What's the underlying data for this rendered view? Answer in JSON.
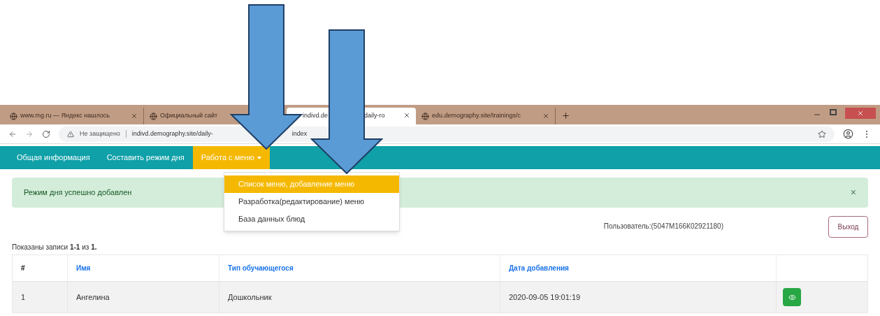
{
  "browser": {
    "tabs": [
      {
        "label": "www.mg.ru — Яндекс нашлось",
        "selected": false
      },
      {
        "label": "Официальный сайт",
        "selected": false
      },
      {
        "label": "indivd.de",
        "label_after": "daily-ro",
        "selected": true
      },
      {
        "label": "edu.demography.site/trainings/c",
        "selected": false
      }
    ],
    "security": "Не защищено",
    "url": "indivd.demography.site/daily-",
    "url_tail": "index"
  },
  "nav": {
    "items": [
      {
        "label": "Общая информация",
        "selected": false
      },
      {
        "label": "Составить режим дня",
        "selected": false
      },
      {
        "label": "Работа с меню",
        "selected": true
      }
    ],
    "dropdown": [
      {
        "label": "Список меню, добавление меню",
        "selected": true
      },
      {
        "label": "Разработка(редактирование) меню",
        "selected": false
      },
      {
        "label": "База данных блюд",
        "selected": false
      }
    ]
  },
  "alert": {
    "message": "Режим дня успешно добавлен",
    "close": "×"
  },
  "user": "Пользователь:(5047М166К02921180)",
  "logout": "Выход",
  "summary": "Показаны записи **1-1** из **1.**",
  "table": {
    "columns": [
      "#",
      "Имя",
      "Тип обучающегося",
      "Дата добавления"
    ],
    "rows": [
      [
        "1",
        "Ангелина",
        "Дошкольник",
        "2020-09-05 19:01:19"
      ]
    ]
  }
}
